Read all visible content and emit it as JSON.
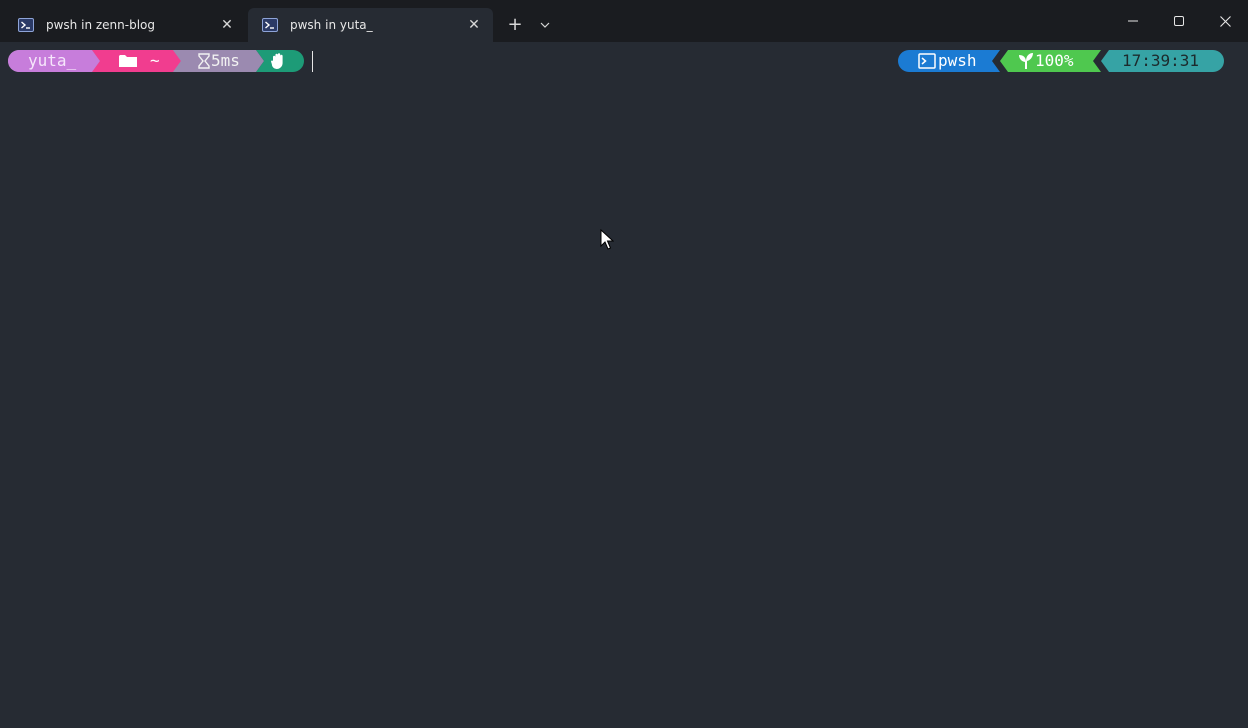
{
  "tabs": [
    {
      "title": "pwsh in zenn-blog",
      "active": false,
      "icon": "powershell-icon"
    },
    {
      "title": "pwsh in yuta_",
      "active": true,
      "icon": "powershell-icon"
    }
  ],
  "tabbar": {
    "new_tab_label": "+",
    "close_label": "✕"
  },
  "prompt": {
    "left": {
      "user": "yuta_",
      "path": "~",
      "duration": "5ms"
    },
    "right": {
      "shell": "pwsh",
      "battery": "100%",
      "time": "17:39:31"
    }
  },
  "colors": {
    "user_segment": "#c77ddb",
    "path_segment": "#f13d8f",
    "duration_segment": "#9b8ab0",
    "status_segment": "#1d9b77",
    "shell_segment": "#1b7bd3",
    "battery_segment": "#4fc84f",
    "time_segment": "#36a3a5",
    "terminal_bg": "#262b33"
  }
}
